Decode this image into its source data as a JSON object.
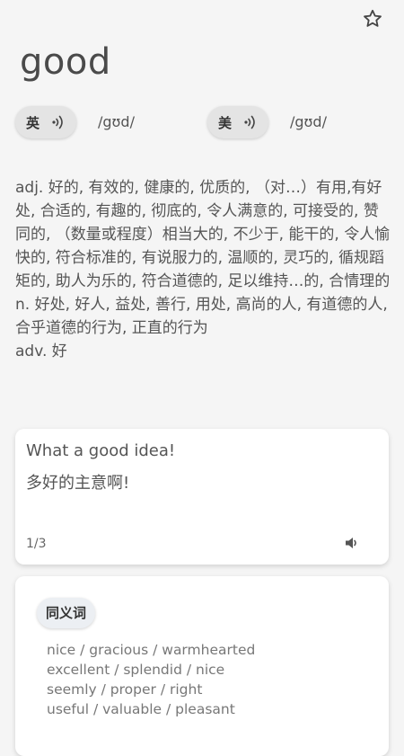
{
  "header": {
    "word": "good",
    "star_icon": "star-outline-icon"
  },
  "pronunciations": [
    {
      "lang": "英",
      "phonetic": "/gʊd/"
    },
    {
      "lang": "美",
      "phonetic": "/gʊd/"
    }
  ],
  "definitions": [
    "adj. 好的, 有效的, 健康的, 优质的, （对…）有用,有好处, 合适的, 有趣的, 彻底的, 令人满意的, 可接受的, 赞同的, （数量或程度）相当大的, 不少于, 能干的, 令人愉快的, 符合标准的, 有说服力的, 温顺的, 灵巧的, 循规蹈矩的, 助人为乐的, 符合道德的, 足以维持…的, 合情理的",
    "n. 好处, 好人, 益处, 善行, 用处, 高尚的人, 有道德的人, 合乎道德的行为, 正直的行为",
    "adv. 好"
  ],
  "example": {
    "english": "What a good idea!",
    "chinese": "多好的主意啊!",
    "page": "1/3"
  },
  "synonyms": {
    "label": "同义词",
    "lines": [
      "nice / gracious / warmhearted",
      "excellent / splendid / nice",
      "seemly / proper / right",
      "useful / valuable / pleasant"
    ]
  }
}
